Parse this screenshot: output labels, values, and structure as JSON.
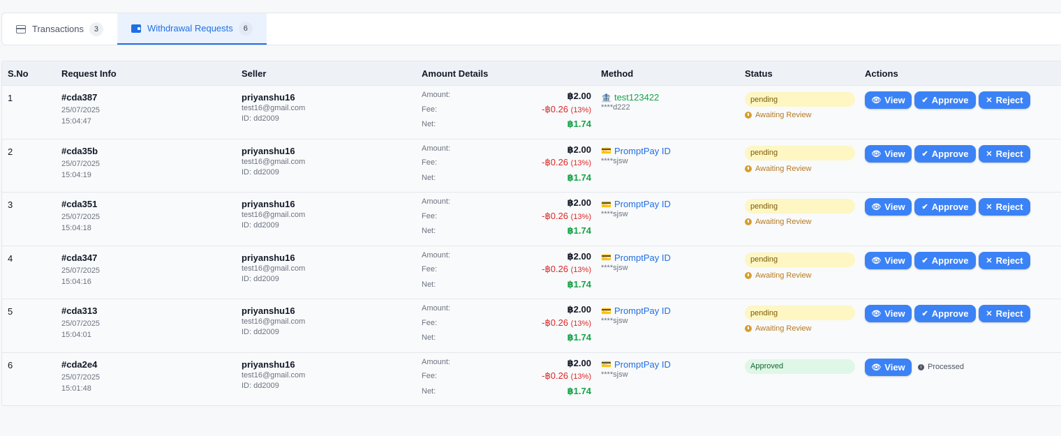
{
  "tabs": [
    {
      "label": "Transactions",
      "count": "3",
      "icon": "credit-card-icon",
      "active": false
    },
    {
      "label": "Withdrawal Requests",
      "count": "6",
      "icon": "wallet-icon",
      "active": true
    }
  ],
  "table": {
    "headers": [
      "S.No",
      "Request Info",
      "Seller",
      "Amount Details",
      "Method",
      "Status",
      "Actions"
    ],
    "labels": {
      "amount": "Amount:",
      "fee": "Fee:",
      "net": "Net:"
    },
    "buttons": {
      "view": "View",
      "approve": "Approve",
      "reject": "Reject"
    },
    "rows": [
      {
        "sno": "1",
        "id": "#cda387",
        "date": "25/07/2025",
        "time": "15:04:47",
        "seller": "priyanshu16",
        "email": "test16@gmail.com",
        "seller_id": "ID: dd2009",
        "amount": "฿2.00",
        "fee": "-฿0.26",
        "fee_pct": "(13%)",
        "net": "฿1.74",
        "method": "test123422",
        "method_glyph": "🏦",
        "acct": "****d222",
        "status": "pending",
        "note": "Awaiting Review"
      },
      {
        "sno": "2",
        "id": "#cda35b",
        "date": "25/07/2025",
        "time": "15:04:19",
        "seller": "priyanshu16",
        "email": "test16@gmail.com",
        "seller_id": "ID: dd2009",
        "amount": "฿2.00",
        "fee": "-฿0.26",
        "fee_pct": "(13%)",
        "net": "฿1.74",
        "method": "PromptPay ID",
        "method_glyph": "💳",
        "acct": "****sjsw",
        "status": "pending",
        "note": "Awaiting Review"
      },
      {
        "sno": "3",
        "id": "#cda351",
        "date": "25/07/2025",
        "time": "15:04:18",
        "seller": "priyanshu16",
        "email": "test16@gmail.com",
        "seller_id": "ID: dd2009",
        "amount": "฿2.00",
        "fee": "-฿0.26",
        "fee_pct": "(13%)",
        "net": "฿1.74",
        "method": "PromptPay ID",
        "method_glyph": "💳",
        "acct": "****sjsw",
        "status": "pending",
        "note": "Awaiting Review"
      },
      {
        "sno": "4",
        "id": "#cda347",
        "date": "25/07/2025",
        "time": "15:04:16",
        "seller": "priyanshu16",
        "email": "test16@gmail.com",
        "seller_id": "ID: dd2009",
        "amount": "฿2.00",
        "fee": "-฿0.26",
        "fee_pct": "(13%)",
        "net": "฿1.74",
        "method": "PromptPay ID",
        "method_glyph": "💳",
        "acct": "****sjsw",
        "status": "pending",
        "note": "Awaiting Review"
      },
      {
        "sno": "5",
        "id": "#cda313",
        "date": "25/07/2025",
        "time": "15:04:01",
        "seller": "priyanshu16",
        "email": "test16@gmail.com",
        "seller_id": "ID: dd2009",
        "amount": "฿2.00",
        "fee": "-฿0.26",
        "fee_pct": "(13%)",
        "net": "฿1.74",
        "method": "PromptPay ID",
        "method_glyph": "💳",
        "acct": "****sjsw",
        "status": "pending",
        "note": "Awaiting Review"
      },
      {
        "sno": "6",
        "id": "#cda2e4",
        "date": "25/07/2025",
        "time": "15:01:48",
        "seller": "priyanshu16",
        "email": "test16@gmail.com",
        "seller_id": "ID: dd2009",
        "amount": "฿2.00",
        "fee": "-฿0.26",
        "fee_pct": "(13%)",
        "net": "฿1.74",
        "method": "PromptPay ID",
        "method_glyph": "💳",
        "acct": "****sjsw",
        "status": "Approved",
        "note": "Processed"
      }
    ]
  },
  "colors": {
    "accent": "#3b82f6",
    "pending_bg": "#fef6c3",
    "approved_bg": "#dff7e7",
    "fee": "#dc2626",
    "net": "#16a34a"
  }
}
